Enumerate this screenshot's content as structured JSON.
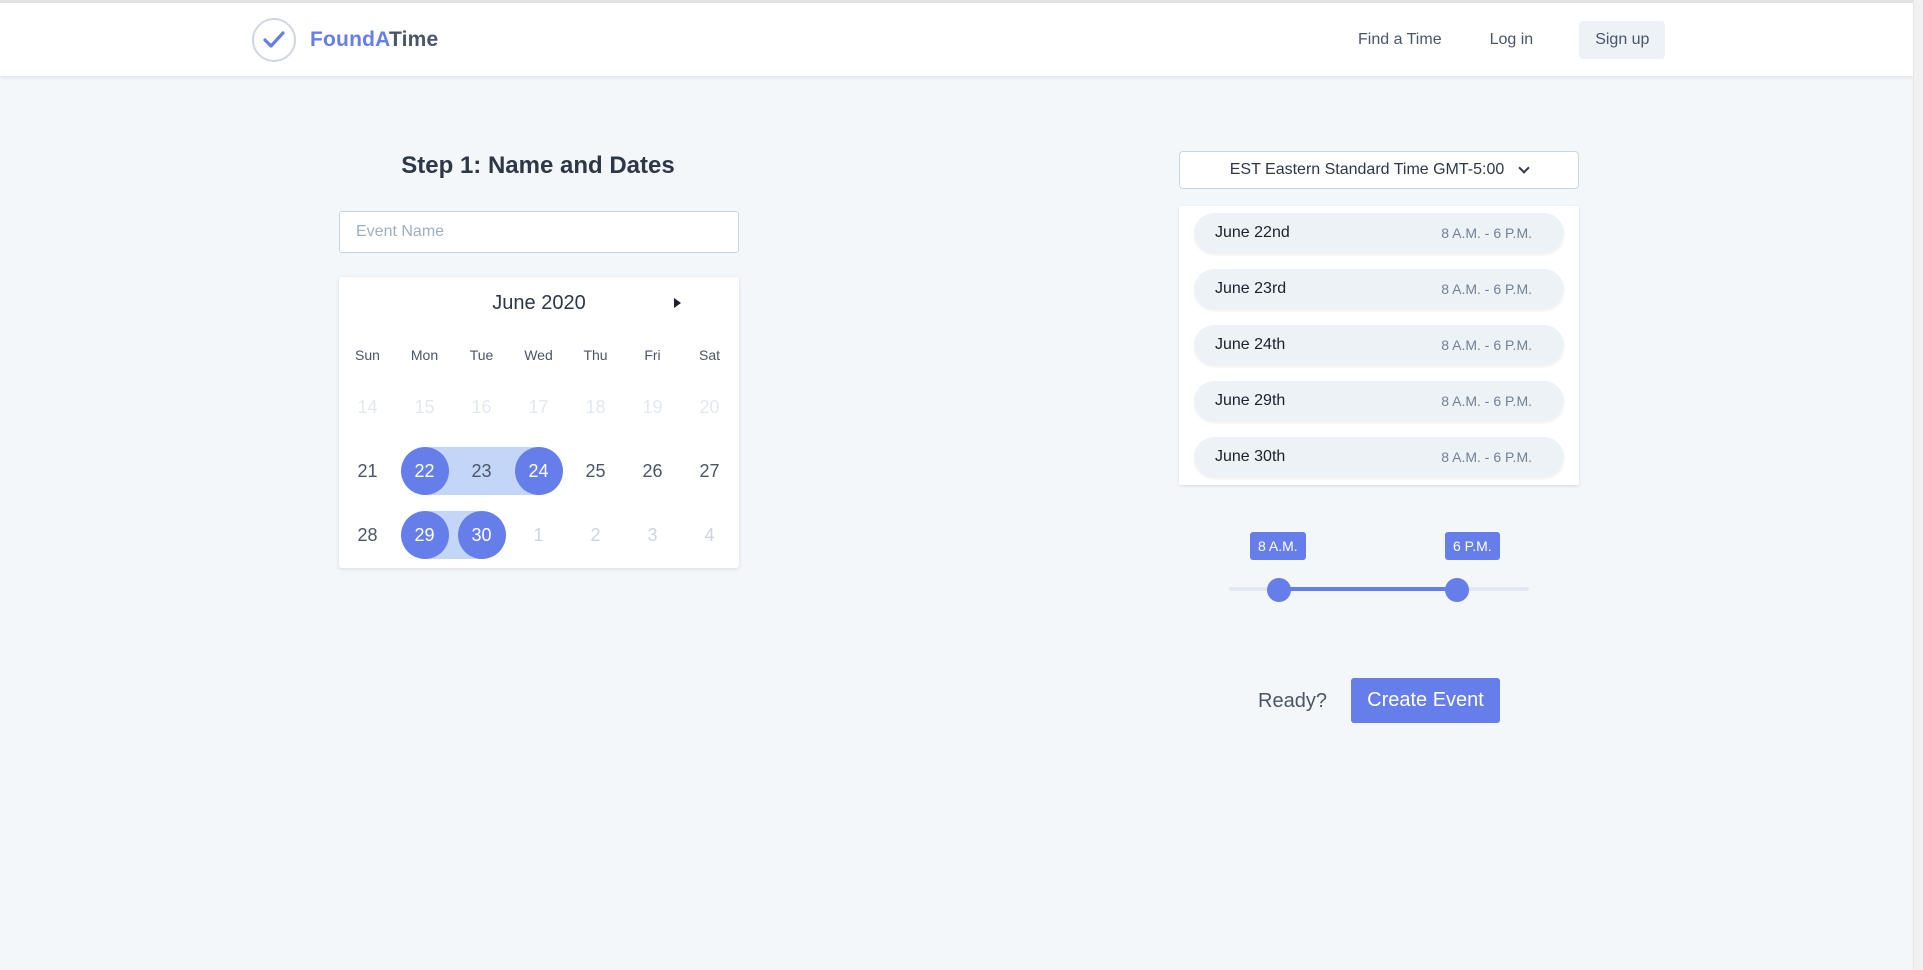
{
  "header": {
    "brand_part1": "FoundA",
    "brand_part2": "Time",
    "logo_icon": "check-circle-icon",
    "nav": [
      "Find a Time",
      "Log in",
      "Sign up"
    ]
  },
  "step": {
    "label": "Step 1:",
    "title": "Name and Dates"
  },
  "event_name": {
    "value": "",
    "placeholder": "Event Name"
  },
  "calendar": {
    "month_label": "June 2020",
    "weekdays": [
      "Sun",
      "Mon",
      "Tue",
      "Wed",
      "Thu",
      "Fri",
      "Sat"
    ],
    "weeks": [
      [
        "14",
        "15",
        "16",
        "17",
        "18",
        "19",
        "20"
      ],
      [
        "21",
        "22",
        "23",
        "24",
        "25",
        "26",
        "27"
      ],
      [
        "28",
        "29",
        "30",
        "1",
        "2",
        "3",
        "4"
      ]
    ],
    "selected": [
      "22",
      "23",
      "24",
      "29",
      "30"
    ],
    "next_icon": "caret-right-icon"
  },
  "timezone": {
    "selected": "EST Eastern Standard Time GMT-5:00",
    "icon": "chevron-down-icon"
  },
  "selected_dates": [
    {
      "date": "June 22nd",
      "range": "8 A.M. - 6 P.M."
    },
    {
      "date": "June 23rd",
      "range": "8 A.M. - 6 P.M."
    },
    {
      "date": "June 24th",
      "range": "8 A.M. - 6 P.M."
    },
    {
      "date": "June 29th",
      "range": "8 A.M. - 6 P.M."
    },
    {
      "date": "June 30th",
      "range": "8 A.M. - 6 P.M."
    }
  ],
  "time_range": {
    "start_label": "8 A.M.",
    "end_label": "6 P.M."
  },
  "footer": {
    "ready_text": "Ready?",
    "create_label": "Create Event"
  },
  "colors": {
    "accent": "#667eea",
    "range_highlight": "#c3d6f7",
    "background": "#f4f7fa"
  }
}
